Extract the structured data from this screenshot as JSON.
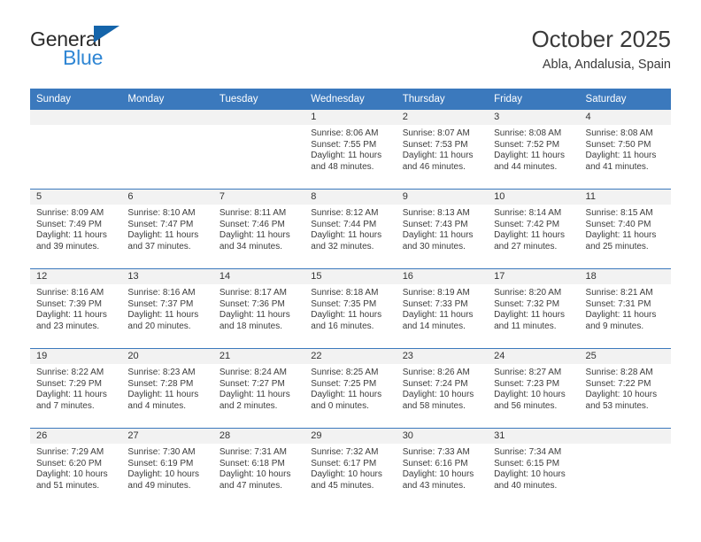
{
  "brand": {
    "line1": "General",
    "line2": "Blue",
    "triangle_color": "#1464aa",
    "blue_text_color": "#2f86d4"
  },
  "header": {
    "title": "October 2025",
    "subtitle": "Abla, Andalusia, Spain"
  },
  "theme": {
    "header_blue": "#3b79bd",
    "day_band_gray": "#f2f2f2"
  },
  "calendar": {
    "weekday_headers": [
      "Sunday",
      "Monday",
      "Tuesday",
      "Wednesday",
      "Thursday",
      "Friday",
      "Saturday"
    ],
    "weeks": [
      [
        {
          "day": "",
          "empty": true
        },
        {
          "day": "",
          "empty": true
        },
        {
          "day": "",
          "empty": true
        },
        {
          "day": "1",
          "sunrise": "Sunrise: 8:06 AM",
          "sunset": "Sunset: 7:55 PM",
          "daylight_line1": "Daylight: 11 hours",
          "daylight_line2": "and 48 minutes."
        },
        {
          "day": "2",
          "sunrise": "Sunrise: 8:07 AM",
          "sunset": "Sunset: 7:53 PM",
          "daylight_line1": "Daylight: 11 hours",
          "daylight_line2": "and 46 minutes."
        },
        {
          "day": "3",
          "sunrise": "Sunrise: 8:08 AM",
          "sunset": "Sunset: 7:52 PM",
          "daylight_line1": "Daylight: 11 hours",
          "daylight_line2": "and 44 minutes."
        },
        {
          "day": "4",
          "sunrise": "Sunrise: 8:08 AM",
          "sunset": "Sunset: 7:50 PM",
          "daylight_line1": "Daylight: 11 hours",
          "daylight_line2": "and 41 minutes."
        }
      ],
      [
        {
          "day": "5",
          "sunrise": "Sunrise: 8:09 AM",
          "sunset": "Sunset: 7:49 PM",
          "daylight_line1": "Daylight: 11 hours",
          "daylight_line2": "and 39 minutes."
        },
        {
          "day": "6",
          "sunrise": "Sunrise: 8:10 AM",
          "sunset": "Sunset: 7:47 PM",
          "daylight_line1": "Daylight: 11 hours",
          "daylight_line2": "and 37 minutes."
        },
        {
          "day": "7",
          "sunrise": "Sunrise: 8:11 AM",
          "sunset": "Sunset: 7:46 PM",
          "daylight_line1": "Daylight: 11 hours",
          "daylight_line2": "and 34 minutes."
        },
        {
          "day": "8",
          "sunrise": "Sunrise: 8:12 AM",
          "sunset": "Sunset: 7:44 PM",
          "daylight_line1": "Daylight: 11 hours",
          "daylight_line2": "and 32 minutes."
        },
        {
          "day": "9",
          "sunrise": "Sunrise: 8:13 AM",
          "sunset": "Sunset: 7:43 PM",
          "daylight_line1": "Daylight: 11 hours",
          "daylight_line2": "and 30 minutes."
        },
        {
          "day": "10",
          "sunrise": "Sunrise: 8:14 AM",
          "sunset": "Sunset: 7:42 PM",
          "daylight_line1": "Daylight: 11 hours",
          "daylight_line2": "and 27 minutes."
        },
        {
          "day": "11",
          "sunrise": "Sunrise: 8:15 AM",
          "sunset": "Sunset: 7:40 PM",
          "daylight_line1": "Daylight: 11 hours",
          "daylight_line2": "and 25 minutes."
        }
      ],
      [
        {
          "day": "12",
          "sunrise": "Sunrise: 8:16 AM",
          "sunset": "Sunset: 7:39 PM",
          "daylight_line1": "Daylight: 11 hours",
          "daylight_line2": "and 23 minutes."
        },
        {
          "day": "13",
          "sunrise": "Sunrise: 8:16 AM",
          "sunset": "Sunset: 7:37 PM",
          "daylight_line1": "Daylight: 11 hours",
          "daylight_line2": "and 20 minutes."
        },
        {
          "day": "14",
          "sunrise": "Sunrise: 8:17 AM",
          "sunset": "Sunset: 7:36 PM",
          "daylight_line1": "Daylight: 11 hours",
          "daylight_line2": "and 18 minutes."
        },
        {
          "day": "15",
          "sunrise": "Sunrise: 8:18 AM",
          "sunset": "Sunset: 7:35 PM",
          "daylight_line1": "Daylight: 11 hours",
          "daylight_line2": "and 16 minutes."
        },
        {
          "day": "16",
          "sunrise": "Sunrise: 8:19 AM",
          "sunset": "Sunset: 7:33 PM",
          "daylight_line1": "Daylight: 11 hours",
          "daylight_line2": "and 14 minutes."
        },
        {
          "day": "17",
          "sunrise": "Sunrise: 8:20 AM",
          "sunset": "Sunset: 7:32 PM",
          "daylight_line1": "Daylight: 11 hours",
          "daylight_line2": "and 11 minutes."
        },
        {
          "day": "18",
          "sunrise": "Sunrise: 8:21 AM",
          "sunset": "Sunset: 7:31 PM",
          "daylight_line1": "Daylight: 11 hours",
          "daylight_line2": "and 9 minutes."
        }
      ],
      [
        {
          "day": "19",
          "sunrise": "Sunrise: 8:22 AM",
          "sunset": "Sunset: 7:29 PM",
          "daylight_line1": "Daylight: 11 hours",
          "daylight_line2": "and 7 minutes."
        },
        {
          "day": "20",
          "sunrise": "Sunrise: 8:23 AM",
          "sunset": "Sunset: 7:28 PM",
          "daylight_line1": "Daylight: 11 hours",
          "daylight_line2": "and 4 minutes."
        },
        {
          "day": "21",
          "sunrise": "Sunrise: 8:24 AM",
          "sunset": "Sunset: 7:27 PM",
          "daylight_line1": "Daylight: 11 hours",
          "daylight_line2": "and 2 minutes."
        },
        {
          "day": "22",
          "sunrise": "Sunrise: 8:25 AM",
          "sunset": "Sunset: 7:25 PM",
          "daylight_line1": "Daylight: 11 hours",
          "daylight_line2": "and 0 minutes."
        },
        {
          "day": "23",
          "sunrise": "Sunrise: 8:26 AM",
          "sunset": "Sunset: 7:24 PM",
          "daylight_line1": "Daylight: 10 hours",
          "daylight_line2": "and 58 minutes."
        },
        {
          "day": "24",
          "sunrise": "Sunrise: 8:27 AM",
          "sunset": "Sunset: 7:23 PM",
          "daylight_line1": "Daylight: 10 hours",
          "daylight_line2": "and 56 minutes."
        },
        {
          "day": "25",
          "sunrise": "Sunrise: 8:28 AM",
          "sunset": "Sunset: 7:22 PM",
          "daylight_line1": "Daylight: 10 hours",
          "daylight_line2": "and 53 minutes."
        }
      ],
      [
        {
          "day": "26",
          "sunrise": "Sunrise: 7:29 AM",
          "sunset": "Sunset: 6:20 PM",
          "daylight_line1": "Daylight: 10 hours",
          "daylight_line2": "and 51 minutes."
        },
        {
          "day": "27",
          "sunrise": "Sunrise: 7:30 AM",
          "sunset": "Sunset: 6:19 PM",
          "daylight_line1": "Daylight: 10 hours",
          "daylight_line2": "and 49 minutes."
        },
        {
          "day": "28",
          "sunrise": "Sunrise: 7:31 AM",
          "sunset": "Sunset: 6:18 PM",
          "daylight_line1": "Daylight: 10 hours",
          "daylight_line2": "and 47 minutes."
        },
        {
          "day": "29",
          "sunrise": "Sunrise: 7:32 AM",
          "sunset": "Sunset: 6:17 PM",
          "daylight_line1": "Daylight: 10 hours",
          "daylight_line2": "and 45 minutes."
        },
        {
          "day": "30",
          "sunrise": "Sunrise: 7:33 AM",
          "sunset": "Sunset: 6:16 PM",
          "daylight_line1": "Daylight: 10 hours",
          "daylight_line2": "and 43 minutes."
        },
        {
          "day": "31",
          "sunrise": "Sunrise: 7:34 AM",
          "sunset": "Sunset: 6:15 PM",
          "daylight_line1": "Daylight: 10 hours",
          "daylight_line2": "and 40 minutes."
        },
        {
          "day": "",
          "empty": true
        }
      ]
    ]
  }
}
